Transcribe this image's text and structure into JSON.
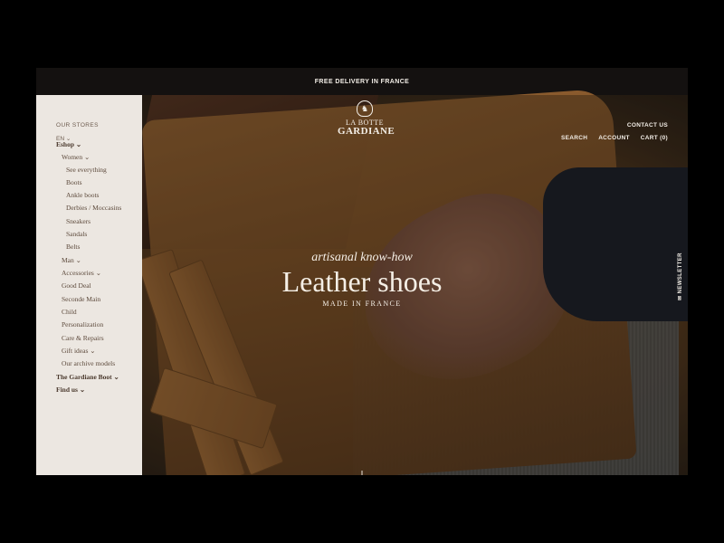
{
  "topbar": {
    "text": "FREE DELIVERY IN FRANCE"
  },
  "header": {
    "logo_line1": "LA BOTTE",
    "logo_line2": "GARDIANE",
    "contact": "CONTACT US",
    "search": "SEARCH",
    "account": "ACCOUNT",
    "cart": "CART (0)"
  },
  "hero": {
    "tagline": "artisanal know-how",
    "headline": "Leather shoes",
    "subhead": "MADE IN FRANCE",
    "newsletter": "NEWSLETTER"
  },
  "sidebar": {
    "stores": "OUR STORES",
    "lang": "EN ⌄",
    "items": [
      {
        "label": "Eshop ⌄"
      },
      {
        "label": "Women ⌄"
      },
      {
        "label": "See everything"
      },
      {
        "label": "Boots"
      },
      {
        "label": "Ankle boots"
      },
      {
        "label": "Derbies / Moccasins"
      },
      {
        "label": "Sneakers"
      },
      {
        "label": "Sandals"
      },
      {
        "label": "Belts"
      },
      {
        "label": "Man ⌄"
      },
      {
        "label": "Accessories ⌄"
      },
      {
        "label": "Good Deal"
      },
      {
        "label": "Seconde Main"
      },
      {
        "label": "Child"
      },
      {
        "label": "Personalization"
      },
      {
        "label": "Care & Repairs"
      },
      {
        "label": "Gift ideas ⌄"
      },
      {
        "label": "Our archive models"
      },
      {
        "label": "The Gardiane Boot ⌄"
      },
      {
        "label": "Find us ⌄"
      }
    ]
  },
  "icons": {
    "logo": "horse-head-emblem-icon",
    "scroll": "arrow-down-icon",
    "newsletter": "mail-icon"
  },
  "colors": {
    "sidebar_bg": "#ece7e1",
    "topbar_bg": "#141110",
    "text_light": "#f3eee7"
  }
}
